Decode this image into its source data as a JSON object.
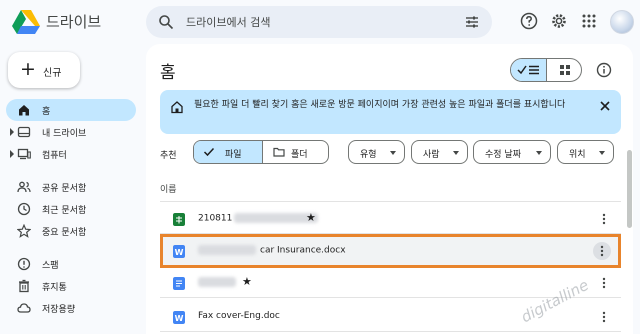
{
  "app": {
    "name": "드라이브"
  },
  "search": {
    "placeholder": "드라이브에서 검색"
  },
  "new_button": {
    "label": "신규"
  },
  "nav": [
    {
      "label": "홈",
      "icon": "home-icon",
      "active": true
    },
    {
      "label": "내 드라이브",
      "icon": "my-drive-icon",
      "active": false
    },
    {
      "label": "컴퓨터",
      "icon": "computer-icon",
      "active": false
    },
    {
      "label": "공유 문서함",
      "icon": "shared-icon",
      "active": false
    },
    {
      "label": "최근 문서함",
      "icon": "recent-icon",
      "active": false
    },
    {
      "label": "중요 문서함",
      "icon": "star-icon",
      "active": false
    },
    {
      "label": "스팸",
      "icon": "spam-icon",
      "active": false
    },
    {
      "label": "휴지통",
      "icon": "trash-icon",
      "active": false
    },
    {
      "label": "저장용량",
      "icon": "cloud-icon",
      "active": false
    }
  ],
  "main": {
    "title": "홈",
    "banner_text": "필요한 파일 더 빨리 찾기  홈은 새로운 방문 페이지이며 가장 관련성 높은 파일과 폴더를 표시합니다",
    "suggested_label": "추천",
    "segment": {
      "files": "파일",
      "folders": "폴더"
    },
    "filters": [
      "유형",
      "사람",
      "수정 날짜",
      "위치"
    ],
    "column_header": "이름",
    "files": [
      {
        "name": "210811",
        "type": "sheets",
        "starred": true,
        "highlight": false
      },
      {
        "name": "car Insurance.docx",
        "type": "word",
        "starred": false,
        "highlight": true
      },
      {
        "name": "",
        "type": "docs",
        "starred": true,
        "highlight": false
      },
      {
        "name": "Fax cover-Eng.doc",
        "type": "word",
        "starred": false,
        "highlight": false
      }
    ]
  },
  "watermark": "digitalline",
  "colors": {
    "accent": "#c2e7ff",
    "highlight_border": "#e8842c",
    "sheets": "#188038",
    "docs": "#4285f4",
    "word": "#2b579a"
  }
}
